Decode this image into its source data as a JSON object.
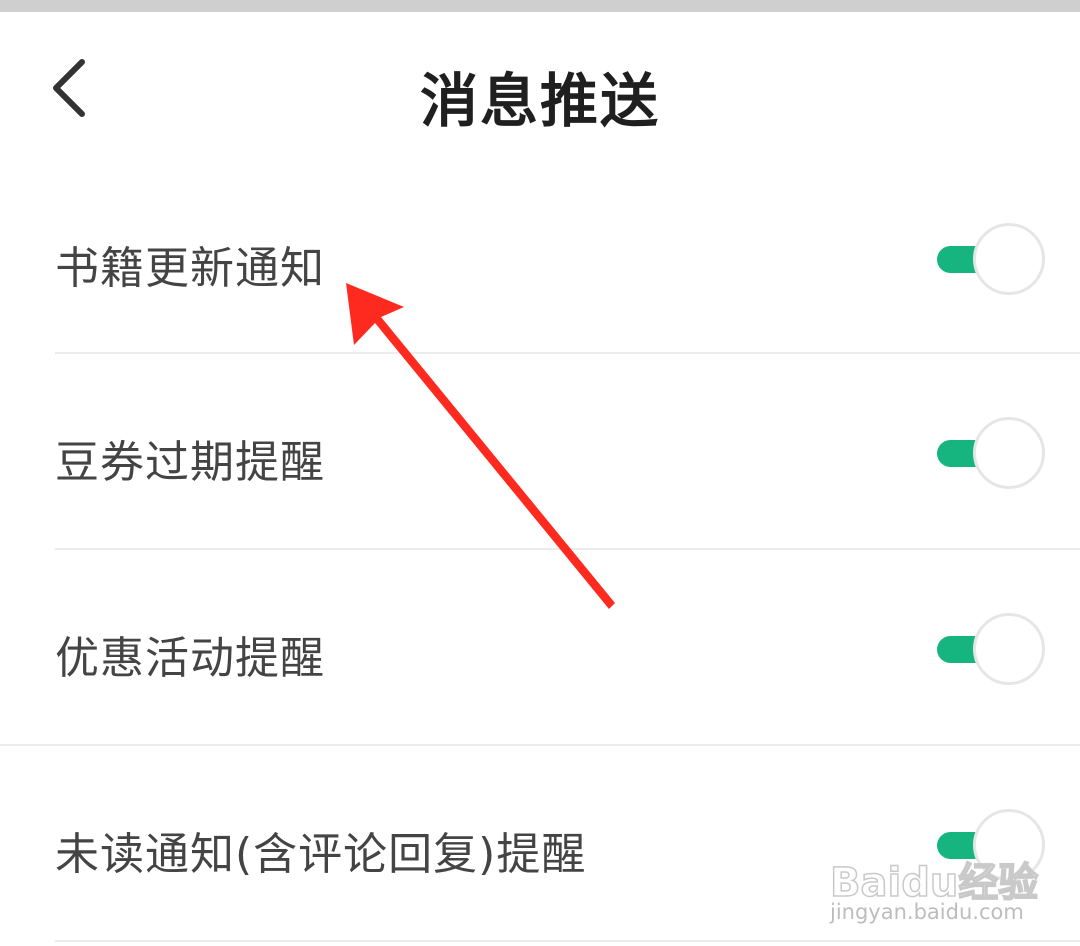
{
  "header": {
    "title": "消息推送",
    "back_icon": "chevron-left-icon"
  },
  "settings": [
    {
      "label": "书籍更新通知",
      "enabled": true
    },
    {
      "label": "豆券过期提醒",
      "enabled": true
    },
    {
      "label": "优惠活动提醒",
      "enabled": true
    },
    {
      "label": "未读通知(含评论回复)提醒",
      "enabled": true
    }
  ],
  "colors": {
    "toggle_on": "#16b47f",
    "annotation_arrow": "#ff2a1f",
    "title_text": "#1f1f1f",
    "label_text": "#444444"
  },
  "watermark": {
    "brand": "Baidu经验",
    "url": "jingyan.baidu.com"
  }
}
